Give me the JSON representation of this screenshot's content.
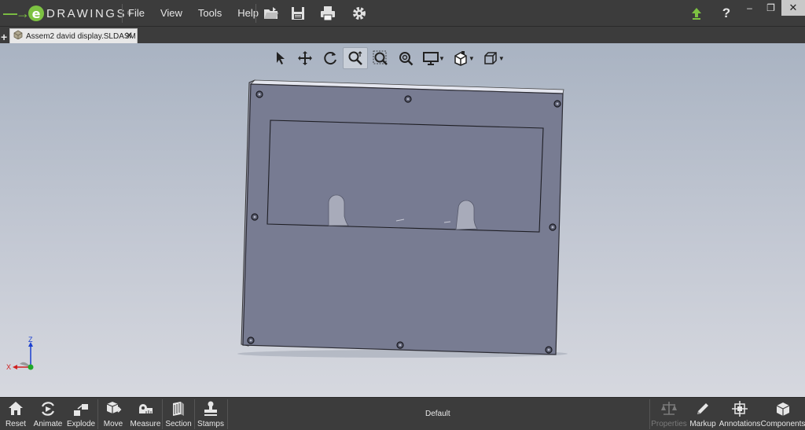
{
  "app": {
    "brand": "DRAWINGS",
    "brand_prefix": "e",
    "tm": "®"
  },
  "menu": {
    "items": [
      "File",
      "View",
      "Tools",
      "Help"
    ]
  },
  "toolbar_icons": [
    "open-folder-icon",
    "save-icon",
    "print-icon",
    "settings-gear-icon"
  ],
  "window_controls": {
    "upload_icon": "upload-arrow-icon",
    "help": "?",
    "minimize": "–",
    "restore": "❐",
    "close": "✕"
  },
  "tabs": {
    "add": "+",
    "document": {
      "label": "Assem2 david display.SLDASM",
      "close": "✕"
    }
  },
  "view_toolbar": {
    "tools": [
      "select-arrow-icon",
      "pan-icon",
      "rotate-icon",
      "zoom-to-fit-icon",
      "zoom-to-area-icon",
      "zoom-in-out-icon",
      "display-style-icon",
      "view-orientation-icon",
      "standard-views-icon"
    ]
  },
  "triad": {
    "z": "Z",
    "x": "X"
  },
  "bottom_bar": {
    "left_buttons": [
      {
        "label": "Reset",
        "icon": "home-icon"
      },
      {
        "label": "Animate",
        "icon": "animate-icon"
      },
      {
        "label": "Explode",
        "icon": "explode-icon"
      },
      {
        "label": "Move",
        "icon": "move-icon"
      },
      {
        "label": "Measure",
        "icon": "measure-icon"
      },
      {
        "label": "Section",
        "icon": "section-icon"
      },
      {
        "label": "Stamps",
        "icon": "stamp-icon"
      }
    ],
    "configuration": "Default",
    "right_buttons": [
      {
        "label": "Properties",
        "icon": "scale-icon",
        "disabled": true
      },
      {
        "label": "Markup",
        "icon": "pencil-icon",
        "disabled": false
      },
      {
        "label": "Annotations",
        "icon": "annotations-icon",
        "disabled": false
      },
      {
        "label": "Components",
        "icon": "components-icon",
        "disabled": false
      }
    ]
  },
  "colors": {
    "accent_green": "#7dc242",
    "chrome_dark": "#3c3c3c",
    "model_face": "#787c92"
  }
}
